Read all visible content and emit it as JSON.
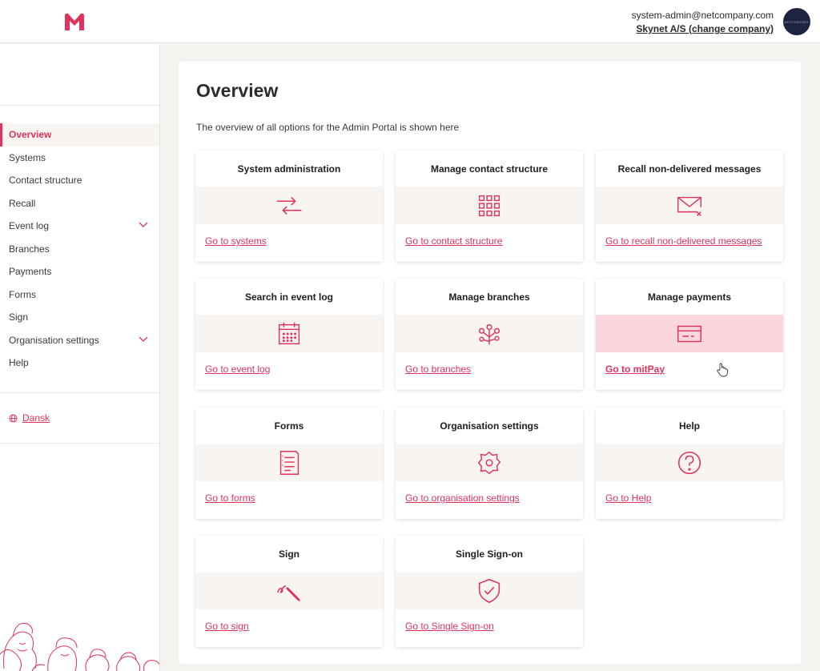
{
  "header": {
    "user_email": "system-admin@netcompany.com",
    "company_link": "Skynet A/S (change company)",
    "avatar_text": "NETCOMPANY",
    "brand_color": "#e0325a"
  },
  "sidebar": {
    "items": [
      {
        "label": "Overview",
        "active": true
      },
      {
        "label": "Systems"
      },
      {
        "label": "Contact structure"
      },
      {
        "label": "Recall"
      },
      {
        "label": "Event log",
        "expandable": true
      },
      {
        "label": "Branches"
      },
      {
        "label": "Payments"
      },
      {
        "label": "Forms"
      },
      {
        "label": "Sign"
      },
      {
        "label": "Organisation settings",
        "expandable": true
      },
      {
        "label": "Help"
      }
    ],
    "language": "Dansk"
  },
  "main": {
    "title": "Overview",
    "subtitle": "The overview of all options for the Admin Portal is shown here",
    "cards": [
      {
        "title": "System administration",
        "icon": "transfer-arrows-icon",
        "link": "Go to systems"
      },
      {
        "title": "Manage contact structure",
        "icon": "grid-icon",
        "link": "Go to contact structure"
      },
      {
        "title": "Recall non-delivered messages",
        "icon": "mail-recall-icon",
        "link": "Go to recall non-delivered messages"
      },
      {
        "title": "Search in event log",
        "icon": "calendar-icon",
        "link": "Go to event log"
      },
      {
        "title": "Manage branches",
        "icon": "branches-tree-icon",
        "link": "Go to branches"
      },
      {
        "title": "Manage payments",
        "icon": "credit-card-icon",
        "link": "Go to mitPay",
        "hovered": true
      },
      {
        "title": "Forms",
        "icon": "form-document-icon",
        "link": "Go to forms"
      },
      {
        "title": "Organisation settings",
        "icon": "settings-gear-icon",
        "link": "Go to organisation settings"
      },
      {
        "title": "Help",
        "icon": "help-circle-icon",
        "link": "Go to Help"
      },
      {
        "title": "Sign",
        "icon": "signature-pen-icon",
        "link": "Go to sign"
      },
      {
        "title": "Single Sign-on",
        "icon": "shield-check-icon",
        "link": "Go to Single Sign-on"
      }
    ]
  }
}
